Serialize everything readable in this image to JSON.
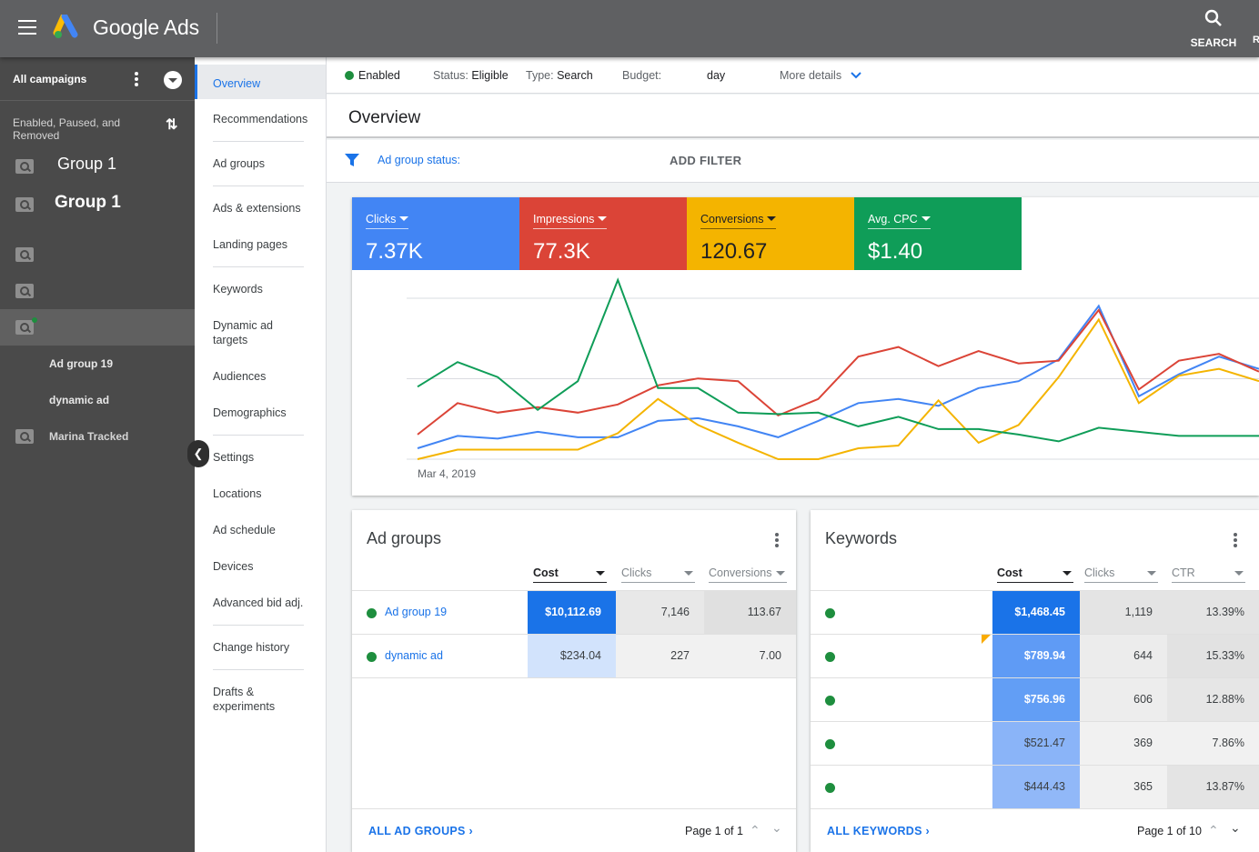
{
  "colors": {
    "blue": "#4285f4",
    "red": "#db4437",
    "amber": "#f4b400",
    "green": "#0f9d58",
    "link": "#1a73e8"
  },
  "topbar": {
    "brand": "Google Ads",
    "search_label": "SEARCH",
    "cut_label": "R"
  },
  "leftnav": {
    "header": "All campaigns",
    "filter": "Enabled, Paused, and Removed",
    "items": [
      {
        "label": "Group 1",
        "icon": "search-campaign-icon"
      },
      {
        "label": "Group 1",
        "icon": "search-campaign-icon"
      },
      {
        "label": "",
        "icon": "search-campaign-icon"
      },
      {
        "label": "",
        "icon": "search-campaign-icon"
      },
      {
        "label": "",
        "icon": "search-campaign-icon"
      },
      {
        "label": "Ad group 19",
        "icon": ""
      },
      {
        "label": "dynamic ad",
        "icon": ""
      },
      {
        "label": "Marina Tracked",
        "icon": "search-campaign-icon"
      }
    ]
  },
  "subnav": {
    "items": [
      "Overview",
      "Recommendations",
      "Ad groups",
      "Ads & extensions",
      "Landing pages",
      "Keywords",
      "Dynamic ad targets",
      "Audiences",
      "Demographics",
      "Settings",
      "Locations",
      "Ad schedule",
      "Devices",
      "Advanced bid adj.",
      "Change history",
      "Drafts & experiments"
    ]
  },
  "status": {
    "enabled": "Enabled",
    "status_label": "Status:",
    "status_value": "Eligible",
    "type_label": "Type:",
    "type_value": "Search",
    "budget_label": "Budget:",
    "budget_value": "day",
    "more": "More details"
  },
  "page_title": "Overview",
  "filter": {
    "label": "Ad group status:",
    "add": "ADD FILTER"
  },
  "tiles": [
    {
      "label": "Clicks",
      "value": "7.37K"
    },
    {
      "label": "Impressions",
      "value": "77.3K"
    },
    {
      "label": "Conversions",
      "value": "120.67"
    },
    {
      "label": "Avg. CPC",
      "value": "$1.40"
    }
  ],
  "chart_data": {
    "type": "line",
    "x_start_label": "Mar 4, 2019",
    "grid": true,
    "ylim": [
      0,
      100
    ],
    "series": [
      {
        "color": "#4285f4",
        "values": [
          8,
          17,
          15,
          20,
          16,
          16,
          28,
          30,
          24,
          16,
          28,
          41,
          44,
          39,
          52,
          57,
          73,
          112,
          46,
          62,
          75,
          66
        ]
      },
      {
        "color": "#db4437",
        "values": [
          18,
          41,
          34,
          38,
          34,
          40,
          54,
          59,
          57,
          32,
          44,
          75,
          82,
          68,
          79,
          70,
          72,
          109,
          51,
          72,
          77,
          64
        ]
      },
      {
        "color": "#f4b400",
        "values": [
          0,
          7,
          7,
          7,
          7,
          19,
          44,
          25,
          12,
          0,
          0,
          8,
          10,
          43,
          12,
          25,
          60,
          102,
          41,
          61,
          66,
          57
        ]
      },
      {
        "color": "#0f9d58",
        "values": [
          53,
          71,
          60,
          36,
          57,
          131,
          52,
          52,
          34,
          33,
          34,
          24,
          31,
          22,
          22,
          18,
          13,
          23,
          20,
          17,
          17,
          17
        ]
      }
    ]
  },
  "adgroups": {
    "title": "Ad groups",
    "columns": [
      "Cost",
      "Clicks",
      "Conversions"
    ],
    "rows": [
      {
        "name": "Ad group 19",
        "cost": "$10,112.69",
        "clicks": "7,146",
        "conv": "113.67"
      },
      {
        "name": "dynamic ad",
        "cost": "$234.04",
        "clicks": "227",
        "conv": "7.00"
      }
    ],
    "footer_link": "ALL AD GROUPS",
    "page": "Page 1 of 1"
  },
  "keywords": {
    "title": "Keywords",
    "columns": [
      "Cost",
      "Clicks",
      "CTR"
    ],
    "rows": [
      {
        "cost": "$1,468.45",
        "clicks": "1,119",
        "ctr": "13.39%"
      },
      {
        "cost": "$789.94",
        "clicks": "644",
        "ctr": "15.33%"
      },
      {
        "cost": "$756.96",
        "clicks": "606",
        "ctr": "12.88%"
      },
      {
        "cost": "$521.47",
        "clicks": "369",
        "ctr": "7.86%"
      },
      {
        "cost": "$444.43",
        "clicks": "365",
        "ctr": "13.87%"
      }
    ],
    "footer_link": "ALL KEYWORDS",
    "page": "Page 1 of 10"
  }
}
